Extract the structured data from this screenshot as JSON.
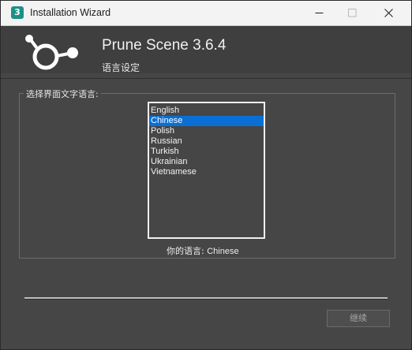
{
  "window": {
    "title": "Installation Wizard",
    "app_icon_glyph": "3"
  },
  "header": {
    "product_title": "Prune Scene 3.6.4",
    "subtitle": "语言设定",
    "logo_icon": "node-link-logo-icon"
  },
  "language_group": {
    "label": "选择界面文字语言:",
    "languages": [
      "English",
      "Chinese",
      "Polish",
      "Russian",
      "Turkish",
      "Ukrainian",
      "Vietnamese"
    ],
    "selected": "Chinese"
  },
  "current_language": {
    "label": "你的语言: ",
    "value": "Chinese"
  },
  "footer": {
    "continue_label": "继续"
  },
  "colors": {
    "selection": "#0a6fd4",
    "panel_bg": "#464646",
    "header_bg": "#3f3f3f",
    "app_icon_bg": "#1f8f86"
  }
}
